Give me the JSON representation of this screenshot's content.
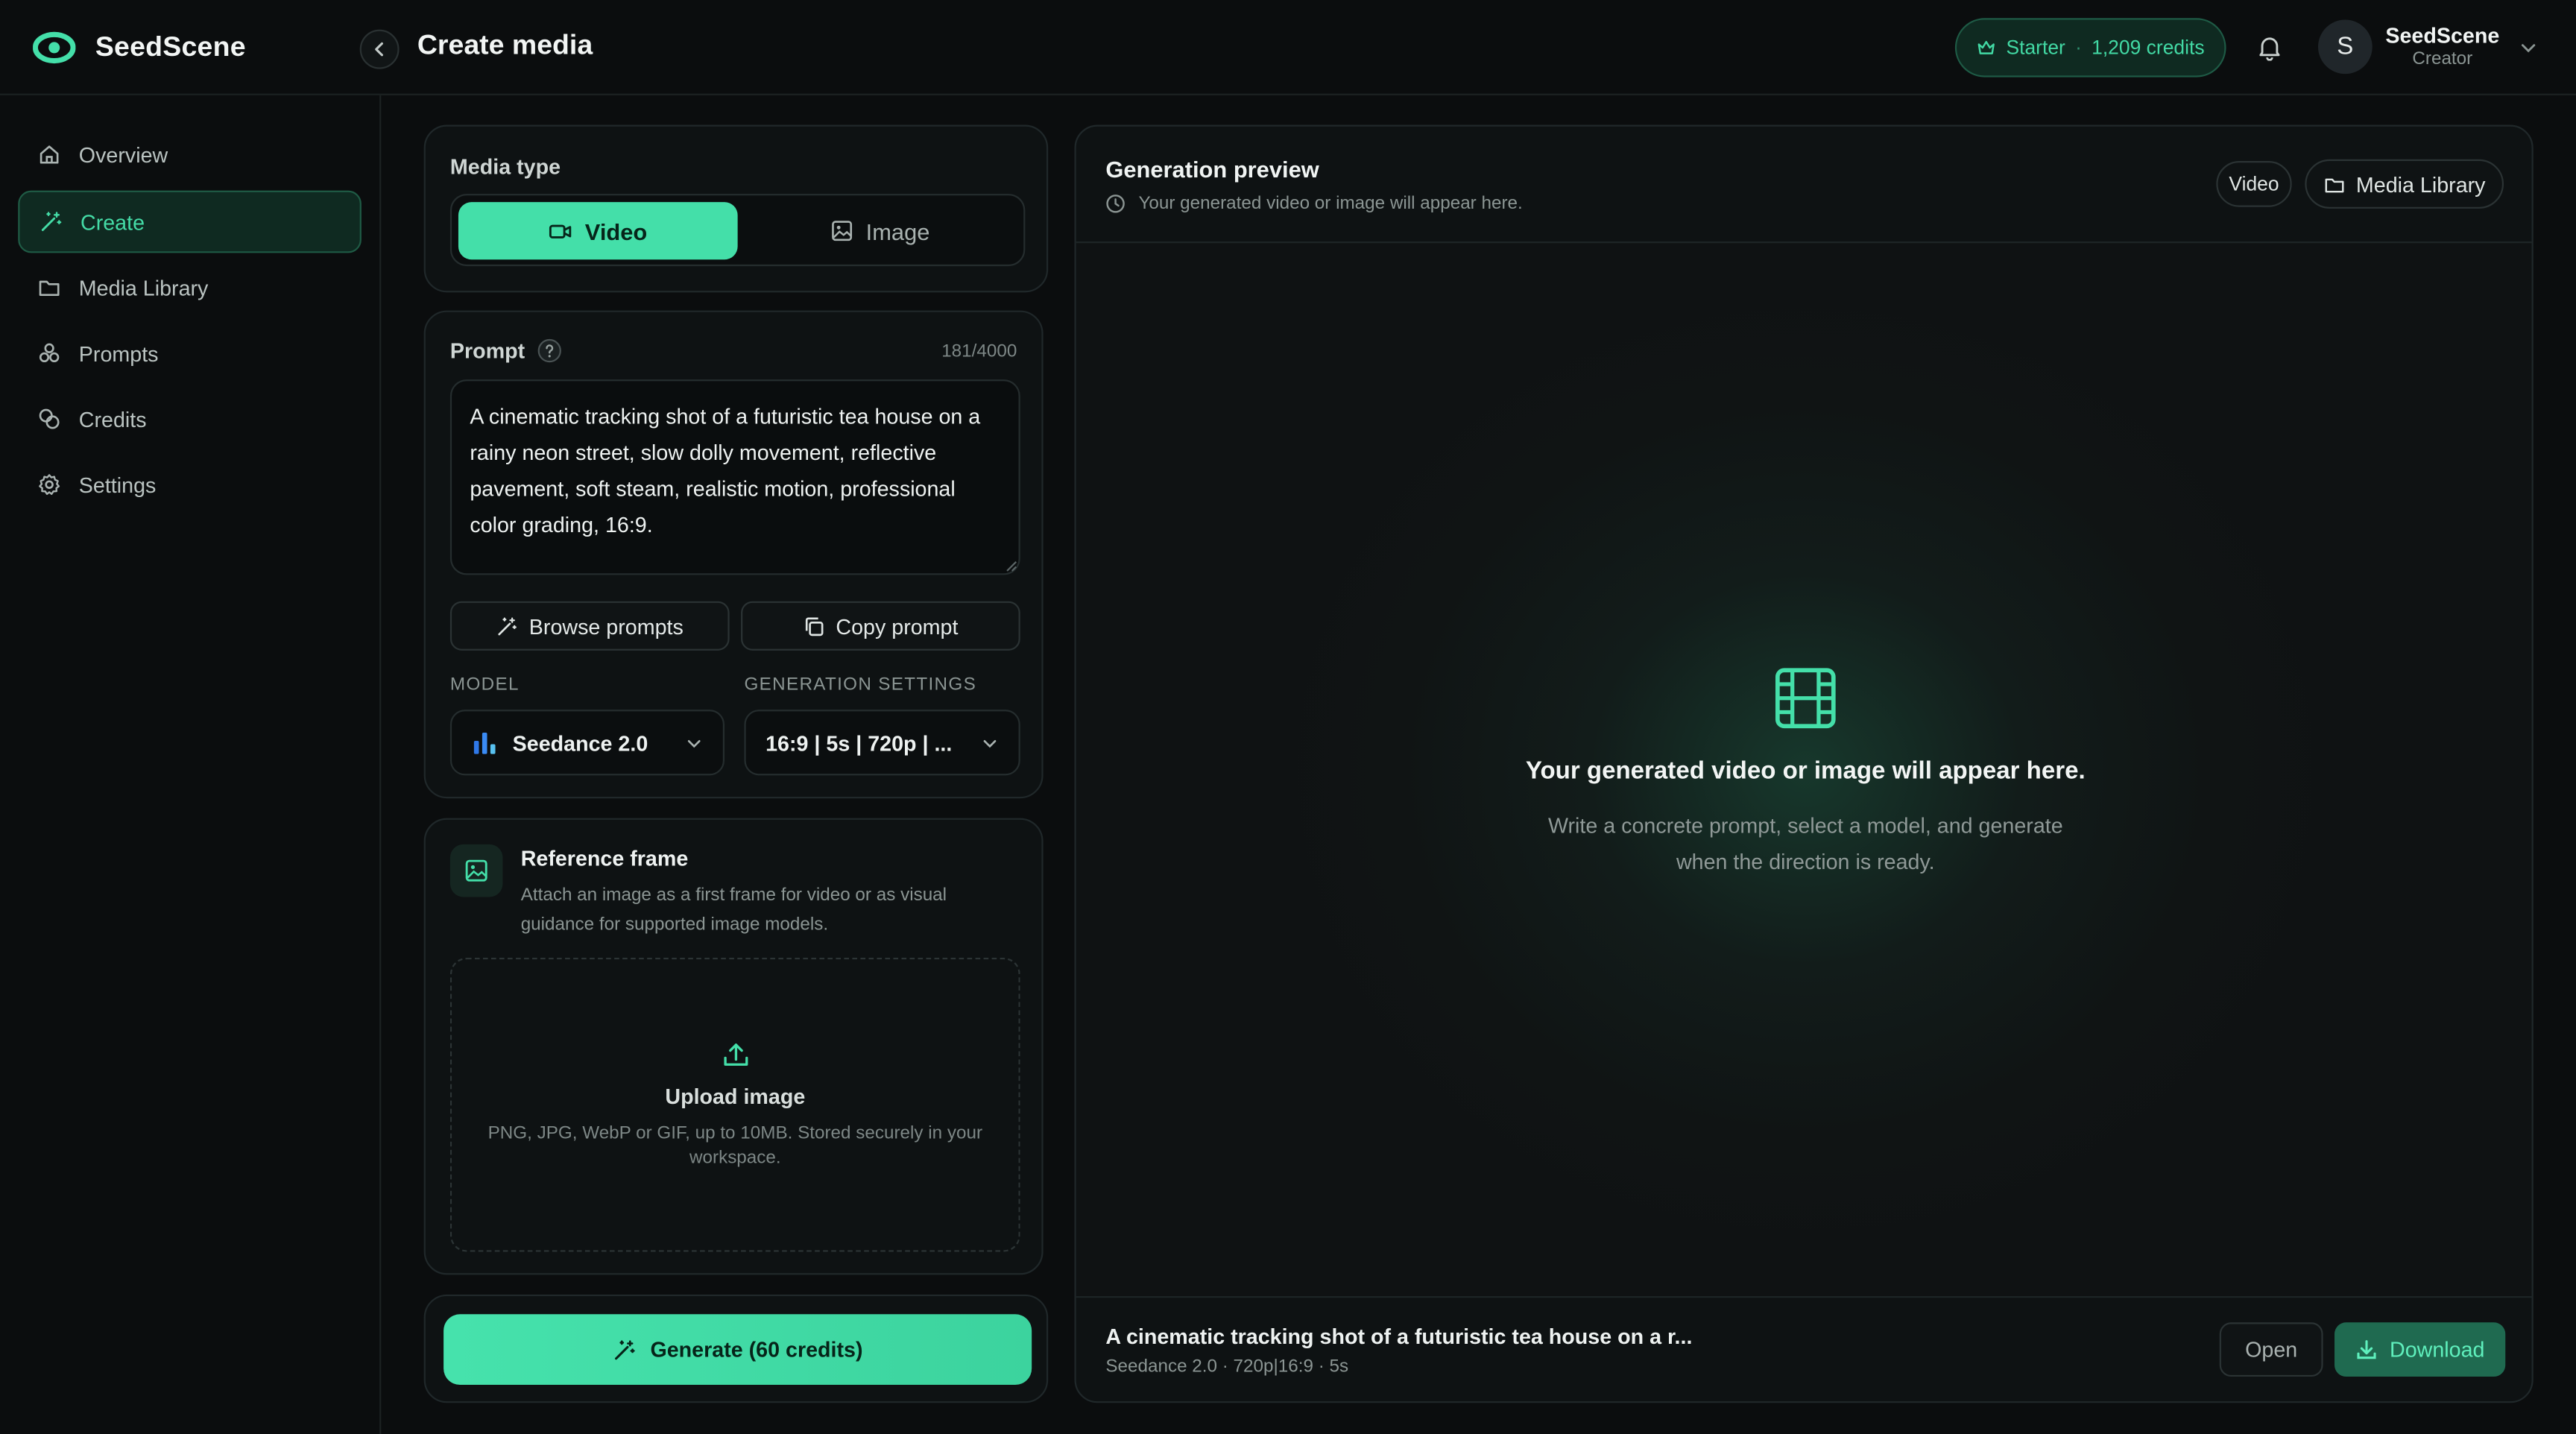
{
  "app": {
    "name": "SeedScene"
  },
  "header": {
    "page_title": "Create media",
    "plan_name": "Starter",
    "plan_separator": "·",
    "credits_text": "1,209 credits",
    "user_initial": "S",
    "user_name": "SeedScene",
    "user_role": "Creator"
  },
  "sidebar": {
    "items": [
      {
        "label": "Overview",
        "icon": "home-icon",
        "active": false
      },
      {
        "label": "Create",
        "icon": "magic-wand-icon",
        "active": true
      },
      {
        "label": "Media Library",
        "icon": "folder-icon",
        "active": false
      },
      {
        "label": "Prompts",
        "icon": "prompts-icon",
        "active": false
      },
      {
        "label": "Credits",
        "icon": "coins-icon",
        "active": false
      },
      {
        "label": "Settings",
        "icon": "gear-icon",
        "active": false
      }
    ]
  },
  "media_type": {
    "label": "Media type",
    "options": [
      {
        "label": "Video",
        "selected": true
      },
      {
        "label": "Image",
        "selected": false
      }
    ]
  },
  "prompt": {
    "label": "Prompt",
    "counter": "181/4000",
    "text": "A cinematic tracking shot of a futuristic tea house on a rainy neon street, slow dolly movement, reflective pavement, soft steam, realistic motion, professional color grading, 16:9.",
    "browse_label": "Browse prompts",
    "copy_label": "Copy prompt"
  },
  "model": {
    "label": "MODEL",
    "value": "Seedance 2.0"
  },
  "generation_settings": {
    "label": "GENERATION SETTINGS",
    "value": "16:9 | 5s | 720p | ..."
  },
  "reference": {
    "title": "Reference frame",
    "description": "Attach an image as a first frame for video or as visual guidance for supported image models.",
    "upload_title": "Upload image",
    "upload_hint": "PNG, JPG, WebP or GIF, up to 10MB. Stored securely in your workspace."
  },
  "generate": {
    "label": "Generate (60 credits)"
  },
  "preview": {
    "title": "Generation preview",
    "subtitle": "Your generated video or image will appear here.",
    "type_pill": "Video",
    "library_label": "Media Library",
    "empty_title": "Your generated video or image will appear here.",
    "empty_body": "Write a concrete prompt, select a model, and generate when the direction is ready.",
    "footer_title": "A cinematic tracking shot of a futuristic tea house on a r...",
    "footer_meta": "Seedance 2.0 · 720p|16:9 · 5s",
    "open_label": "Open",
    "download_label": "Download"
  },
  "colors": {
    "accent": "#44dfa9",
    "background": "#0b0d0e",
    "panel": "#0e1213"
  }
}
